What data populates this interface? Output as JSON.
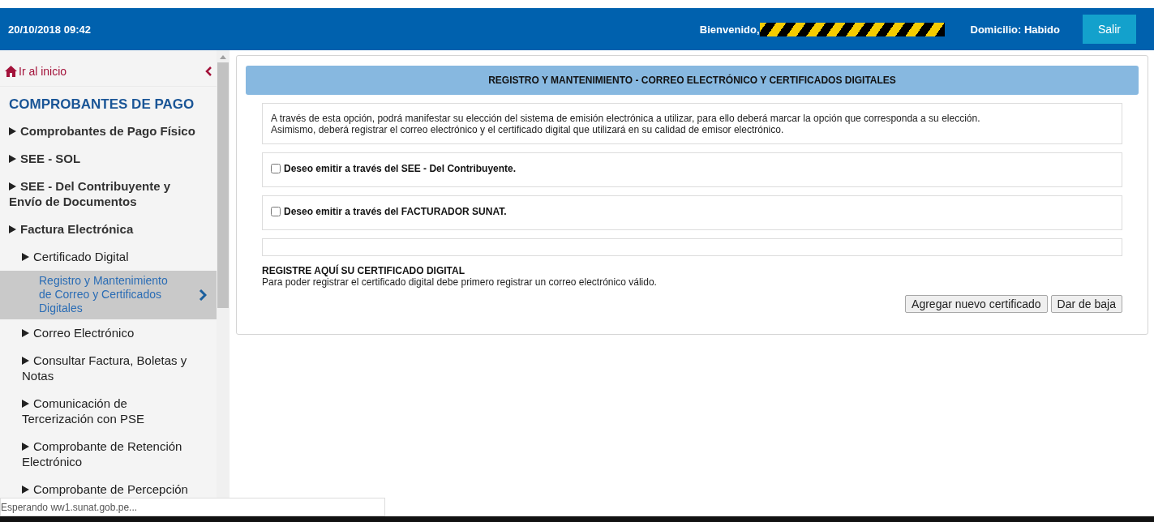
{
  "header": {
    "datetime": "20/10/2018 09:42",
    "welcome": "Bienvenido,",
    "address": "Domicilio: Habido",
    "logout_button": "Salir"
  },
  "sidebar": {
    "home_link": "Ir al inicio",
    "heading": "COMPROBANTES DE PAGO",
    "items": [
      {
        "label": "Comprobantes de Pago Físico",
        "selected": false
      },
      {
        "label": "SEE - SOL",
        "selected": false
      },
      {
        "label": "SEE - Del Contribuyente y Envío de Documentos",
        "selected": false
      },
      {
        "label": "Factura Electrónica",
        "selected": false,
        "children": [
          {
            "label": "Certificado Digital",
            "selected": false,
            "children": [
              {
                "label": "Registro y Mantenimiento de Correo y Certificados Digitales",
                "selected": true
              }
            ]
          },
          {
            "label": "Correo Electrónico",
            "selected": false
          },
          {
            "label": "Consultar Factura, Boletas y Notas",
            "selected": false
          },
          {
            "label": "Comunicación de Tercerización con PSE",
            "selected": false
          },
          {
            "label": "Comprobante de Retención Electrónico",
            "selected": false
          },
          {
            "label": "Comprobante de Percepción",
            "selected": false
          }
        ]
      }
    ]
  },
  "panel": {
    "title": "REGISTRO Y MANTENIMIENTO - CORREO ELECTRÓNICO Y CERTIFICADOS DIGITALES",
    "intro": [
      "A través de esta opción, podrá manifestar su elección del sistema de emisión electrónica a utilizar, para ello deberá marcar la opción que corresponda a su elección.",
      "Asimismo, deberá registrar el correo electrónico y el certificado digital que utilizará en su calidad de emisor electrónico."
    ],
    "options": [
      {
        "label": "Deseo emitir a través del SEE - Del Contribuyente.",
        "checked": false
      },
      {
        "label": "Deseo emitir a través del FACTURADOR SUNAT.",
        "checked": false
      }
    ],
    "certificate_heading": "REGISTRE AQUÍ SU CERTIFICADO DIGITAL",
    "certificate_note": "Para poder registrar el certificado digital debe primero registrar un correo electrónico válido.",
    "buttons": [
      "Agregar nuevo certificado",
      "Dar de baja"
    ]
  },
  "status_bar": "Esperando ww1.sunat.gob.pe..."
}
